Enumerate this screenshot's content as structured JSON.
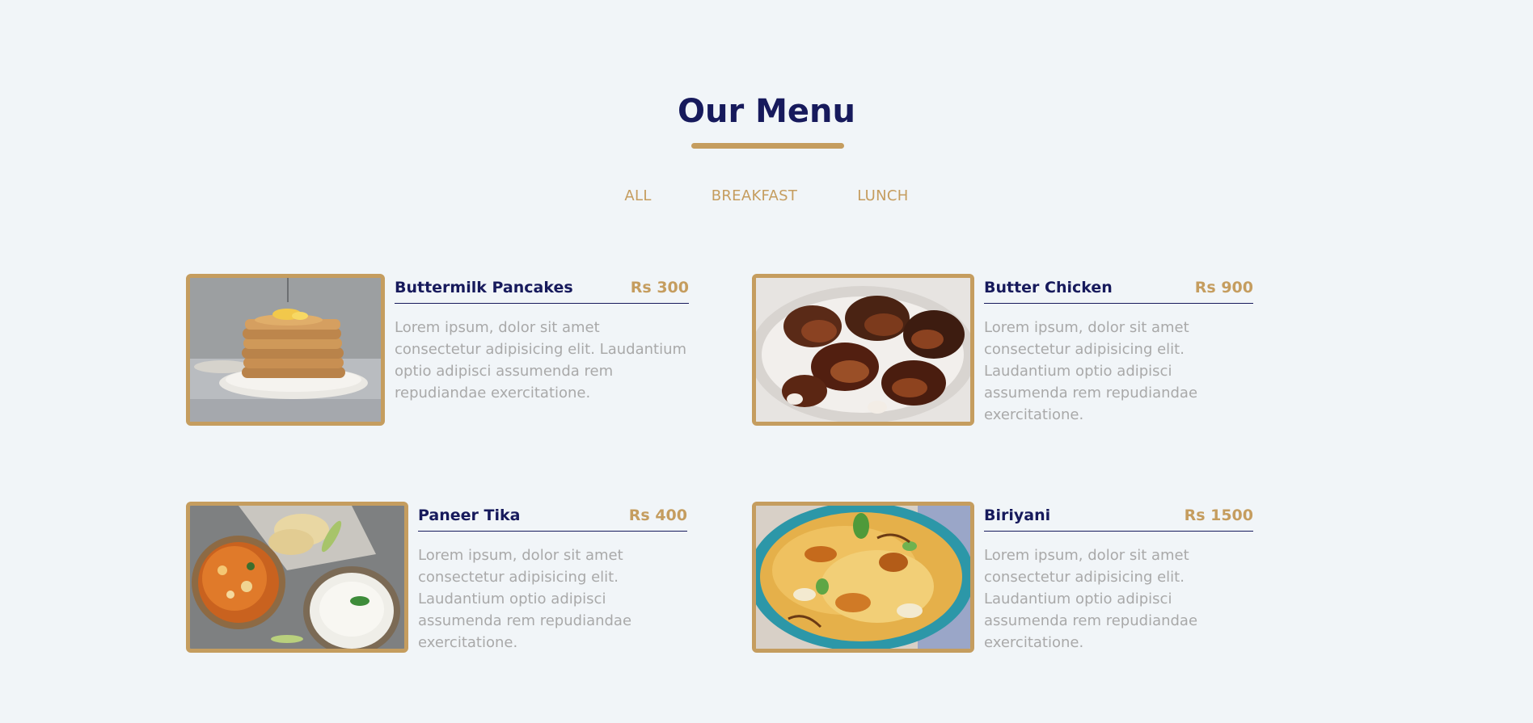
{
  "section": {
    "title": "Our Menu"
  },
  "filters": [
    "ALL",
    "BREAKFAST",
    "LUNCH"
  ],
  "colors": {
    "background": "#f1f5f8",
    "primary": "#171a5c",
    "accent": "#c59d5f",
    "text_muted": "#a9a9a9"
  },
  "menu": [
    {
      "name": "Buttermilk Pancakes",
      "price": "Rs 300",
      "desc": "Lorem ipsum, dolor sit amet consectetur adipisicing elit. Laudantium optio adipisci assumenda rem repudiandae exercitatione.",
      "image": "pancakes-photo"
    },
    {
      "name": "Butter Chicken",
      "price": "Rs 900",
      "desc": "Lorem ipsum, dolor sit amet consectetur adipisicing elit. Laudantium optio adipisci assumenda rem repudiandae exercitatione.",
      "image": "chicken-photo"
    },
    {
      "name": "Paneer Tika",
      "price": "Rs 400",
      "desc": "Lorem ipsum, dolor sit amet consectetur adipisicing elit. Laudantium optio adipisci assumenda rem repudiandae exercitatione.",
      "image": "paneer-photo"
    },
    {
      "name": "Biriyani",
      "price": "Rs 1500",
      "desc": "Lorem ipsum, dolor sit amet consectetur adipisicing elit. Laudantium optio adipisci assumenda rem repudiandae exercitatione.",
      "image": "biriyani-photo"
    }
  ]
}
